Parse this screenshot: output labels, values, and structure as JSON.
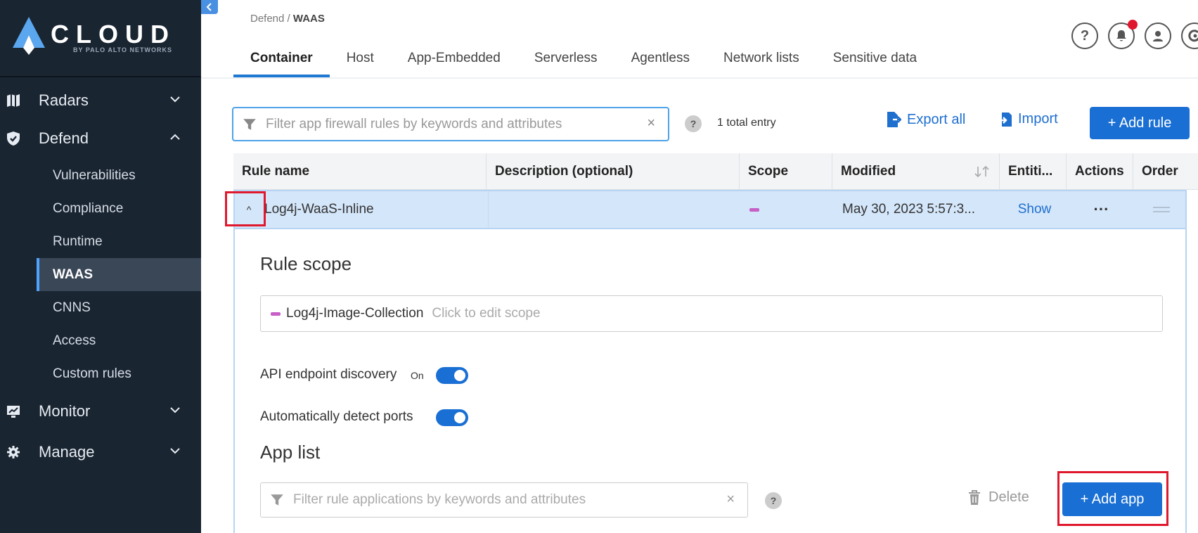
{
  "sidebar": {
    "logo_text": "CLOUD",
    "logo_sub": "BY PALO ALTO NETWORKS",
    "groups": [
      {
        "label": "Radars",
        "icon": "radar-map-icon"
      },
      {
        "label": "Defend",
        "icon": "shield-icon"
      },
      {
        "label": "Monitor",
        "icon": "monitor-icon"
      },
      {
        "label": "Manage",
        "icon": "gear-icon"
      }
    ],
    "defend_items": [
      "Vulnerabilities",
      "Compliance",
      "Runtime",
      "WAAS",
      "CNNS",
      "Access",
      "Custom rules"
    ],
    "active_item": "WAAS"
  },
  "header": {
    "breadcrumb_parent": "Defend /",
    "breadcrumb_current": "WAAS",
    "tabs": [
      "Container",
      "Host",
      "App-Embedded",
      "Serverless",
      "Agentless",
      "Network lists",
      "Sensitive data"
    ],
    "active_tab": "Container",
    "icons": [
      "help-icon",
      "notifications-icon",
      "user-icon",
      "prisma-icon"
    ],
    "help_glyph": "?"
  },
  "toolbar": {
    "filter_placeholder": "Filter app firewall rules by keywords and attributes",
    "clear_glyph": "×",
    "help_glyph": "?",
    "total": "1 total entry",
    "export_label": "Export all",
    "import_label": "Import",
    "add_rule_label": "+ Add rule"
  },
  "table": {
    "columns": [
      "Rule name",
      "Description (optional)",
      "Scope",
      "Modified",
      "Entiti...",
      "Actions",
      "Order"
    ],
    "rows": [
      {
        "name": "Log4j-WaaS-Inline",
        "description": "",
        "modified": "May 30, 2023 5:57:3...",
        "entities": "Show",
        "actions": "···",
        "expand_glyph": "^"
      }
    ]
  },
  "rule_detail": {
    "scope_heading": "Rule scope",
    "scope_name": "Log4j-Image-Collection",
    "scope_hint": "Click to edit scope",
    "api_discovery_label": "API endpoint discovery",
    "api_discovery_state": "On",
    "autodetect_label": "Automatically detect ports",
    "autodetect_state": "On",
    "app_list_heading": "App list",
    "app_filter_placeholder": "Filter rule applications by keywords and attributes",
    "delete_label": "Delete",
    "add_app_label": "+ Add app"
  },
  "colors": {
    "sidebar_bg": "#1a2532",
    "accent": "#1a6fd4",
    "row_selected": "#d4e6fa",
    "highlight_red": "#e0182d",
    "scope_chip": "#c660c6"
  }
}
